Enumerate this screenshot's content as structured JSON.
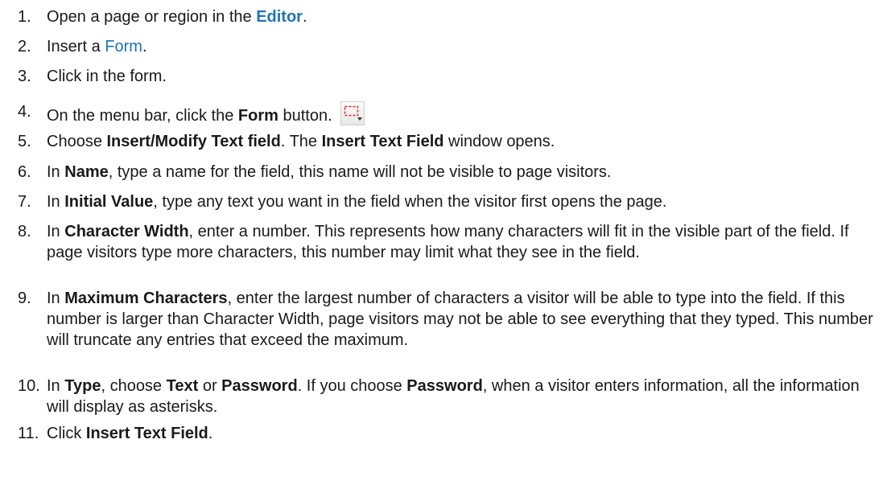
{
  "steps": [
    {
      "num": "1.",
      "t1": "Open a page or region in the ",
      "link": "Editor",
      "t2": "."
    },
    {
      "num": "2.",
      "t1": "Insert a ",
      "link": "Form",
      "t2": "."
    },
    {
      "num": "3.",
      "t1": "Click in the form."
    },
    {
      "num": "4.",
      "t1": "On the menu bar, click the ",
      "b1": "Form",
      "t2": " button.",
      "icon": "form-dropdown-icon"
    },
    {
      "num": "5.",
      "t1": "Choose ",
      "b1": "Insert/Modify Text field",
      "t2": ". The ",
      "b2": "Insert Text Field",
      "t3": " window opens."
    },
    {
      "num": "6.",
      "t1": "In ",
      "b1": "Name",
      "t2": ", type a name for the field, this name will not be visible to page visitors."
    },
    {
      "num": "7.",
      "t1": "In ",
      "b1": "Initial Value",
      "t2": ", type any text you want in the field when the visitor first opens the page."
    },
    {
      "num": "8.",
      "t1": "In ",
      "b1": "Character Width",
      "t2": ", enter a number. This represents how many characters will fit in the visible part of the field.  If page visitors type more characters, this number may limit what they see in the field."
    },
    {
      "num": "9.",
      "t1": "In ",
      "b1": "Maximum Characters",
      "t2": ", enter the largest number of characters a visitor will be able to type into the field. If this number is larger than Character Width, page visitors may not be able to see everything that they typed. This number will truncate any entries that exceed the maximum."
    },
    {
      "num": "10.",
      "t1": "In ",
      "b1": "Type",
      "t2": ", choose ",
      "b2": "Text",
      "t3": " or ",
      "b3": "Password",
      "t4": ". If you choose ",
      "b4": "Password",
      "t5": ", when a visitor enters information, all the information will display as asterisks."
    },
    {
      "num": "11.",
      "t1": "Click ",
      "b1": "Insert Text Field",
      "t2": "."
    }
  ],
  "colors": {
    "link": "#1f74b4",
    "text": "#1a1a1a"
  }
}
